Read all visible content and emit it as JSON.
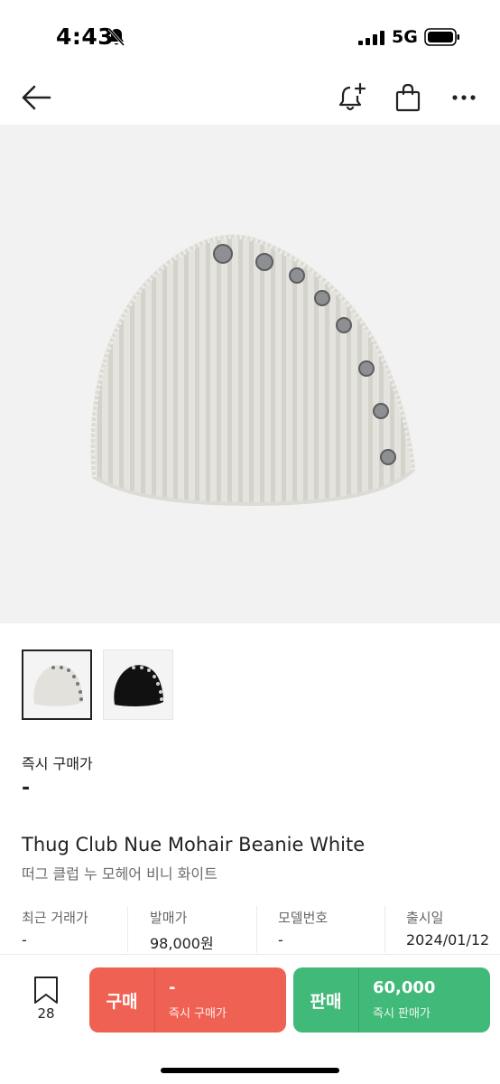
{
  "status_bar": {
    "time": "4:43",
    "network": "5G"
  },
  "nav": {
    "icons": [
      "back-arrow-icon",
      "bell-plus-icon",
      "shopping-bag-icon",
      "more-icon"
    ]
  },
  "product": {
    "image_description_icon": "white-mohair-beanie-image",
    "thumbnails": [
      "white-beanie-thumbnail",
      "black-beanie-thumbnail"
    ],
    "price_label": "즉시 구매가",
    "price_value": "-",
    "title_en": "Thug Club Nue Mohair Beanie White",
    "title_ko": "떠그 클럽 누 모헤어 비니 화이트"
  },
  "info": [
    {
      "key": "최근 거래가",
      "value": "-"
    },
    {
      "key": "발매가",
      "value": "98,000원"
    },
    {
      "key": "모델번호",
      "value": "-"
    },
    {
      "key": "출시일",
      "value": "2024/01/12"
    }
  ],
  "bottom_bar": {
    "wish_count": "28",
    "buy": {
      "label": "구매",
      "price": "-",
      "sub": "즉시 구매가"
    },
    "sell": {
      "label": "판매",
      "price": "60,000",
      "sub": "즉시 판매가"
    }
  },
  "colors": {
    "buy": "#ef6253",
    "sell": "#41b979",
    "image_bg": "#f2f2f2"
  }
}
